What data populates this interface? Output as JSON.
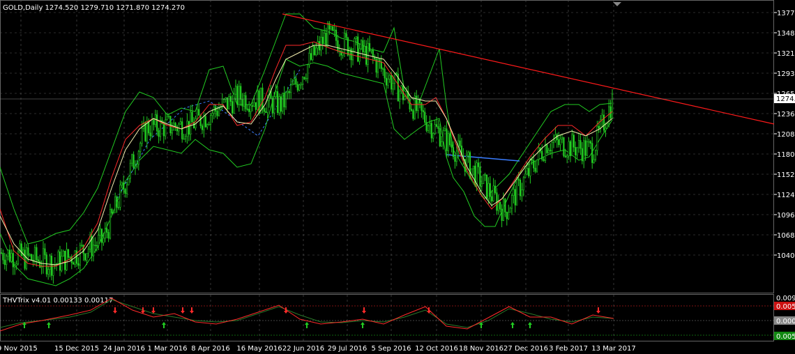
{
  "main_panel": {
    "header": "GOLD,Daily  1274.520 1279.710 1271.870 1274.270",
    "current_price_label": "1274.2",
    "price_labels": [
      "1377.7",
      "1348.9",
      "1321.0",
      "1293.2",
      "1265.3",
      "1236.5",
      "1208.7",
      "1180.9",
      "1152.9",
      "1124.2",
      "1096.3",
      "1068.4",
      "1040.5"
    ]
  },
  "indicator_panel": {
    "header": "THVTrix v4.01 0.00133 0.00117",
    "labels": [
      "0.0095",
      "0.0050",
      "0.0000",
      "0.0050"
    ]
  },
  "date_labels": [
    "9 Nov 2015",
    "15 Dec 2015",
    "24 Jan 2016",
    "1 Mar 2016",
    "8 Apr 2016",
    "16 May 2016",
    "22 Jun 2016",
    "29 Jul 2016",
    "5 Sep 2016",
    "12 Oct 2016",
    "18 Nov 2016",
    "27 Dec 2016",
    "3 Feb 2017",
    "13 Mar 2017"
  ],
  "colors": {
    "background": "#000000",
    "candles": "#22cc22",
    "grid": "#5a5a5a",
    "trendline": "#ff1a1a",
    "blue_line": "#3a7dff",
    "trix_green": "#22cc22",
    "trix_red": "#ff2a2a"
  },
  "chart_data": {
    "type": "candlestick",
    "symbol": "GOLD",
    "timeframe": "Daily",
    "last_ohlc": {
      "open": 1274.52,
      "high": 1279.71,
      "low": 1271.87,
      "close": 1274.27
    },
    "ylim": [
      1040.5,
      1377.7
    ],
    "close_path": [
      {
        "x": "9 Nov 2015",
        "y": 1085
      },
      {
        "x": "15 Dec 2015",
        "y": 1072
      },
      {
        "x": "24 Jan 2016",
        "y": 1100
      },
      {
        "x": "1 Mar 2016",
        "y": 1238
      },
      {
        "x": "8 Apr 2016",
        "y": 1240
      },
      {
        "x": "16 May 2016",
        "y": 1275
      },
      {
        "x": "22 Jun 2016",
        "y": 1265
      },
      {
        "x": "29 Jul 2016",
        "y": 1350
      },
      {
        "x": "5 Sep 2016",
        "y": 1325
      },
      {
        "x": "12 Oct 2016",
        "y": 1260
      },
      {
        "x": "18 Nov 2016",
        "y": 1205
      },
      {
        "x": "27 Dec 2016",
        "y": 1135
      },
      {
        "x": "3 Feb 2017",
        "y": 1220
      },
      {
        "x": "13 Mar 2017",
        "y": 1210
      },
      {
        "x": "13 Mar 2017",
        "y": 1274
      }
    ]
  }
}
